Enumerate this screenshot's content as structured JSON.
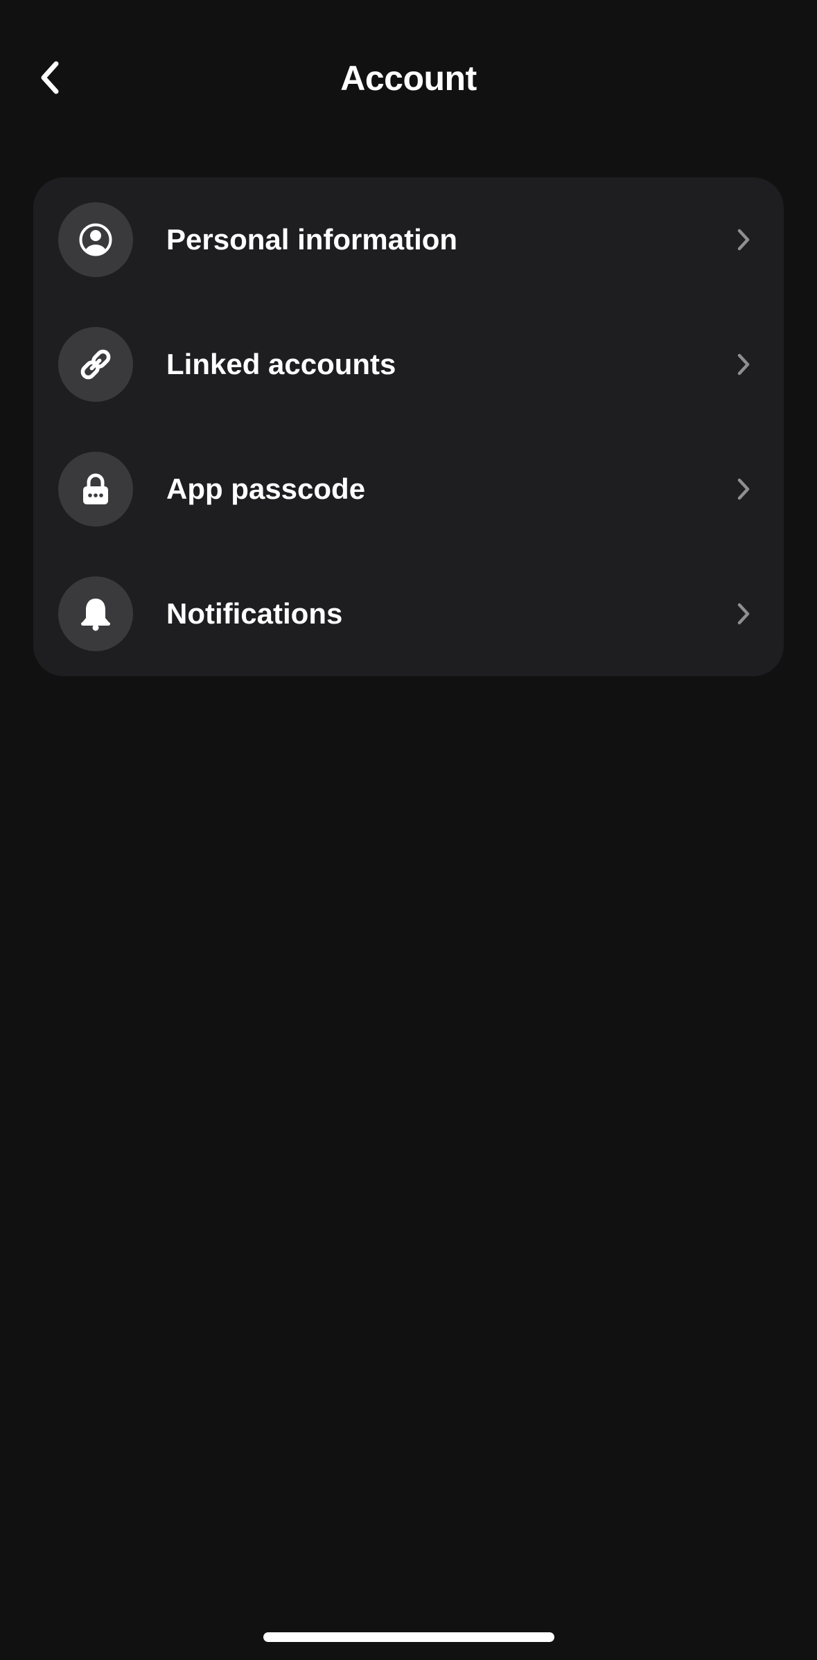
{
  "header": {
    "title": "Account",
    "back_icon": "chevron-left-icon"
  },
  "menu": {
    "items": [
      {
        "label": "Personal information",
        "icon": "user-circle-icon"
      },
      {
        "label": "Linked accounts",
        "icon": "link-icon"
      },
      {
        "label": "App passcode",
        "icon": "lock-icon"
      },
      {
        "label": "Notifications",
        "icon": "bell-icon"
      }
    ],
    "chevron_icon": "chevron-right-icon"
  },
  "colors": {
    "background": "#111111",
    "card": "#1e1e20",
    "icon_circle": "#3a3a3c",
    "text": "#ffffff",
    "chevron": "#8e8e93"
  }
}
